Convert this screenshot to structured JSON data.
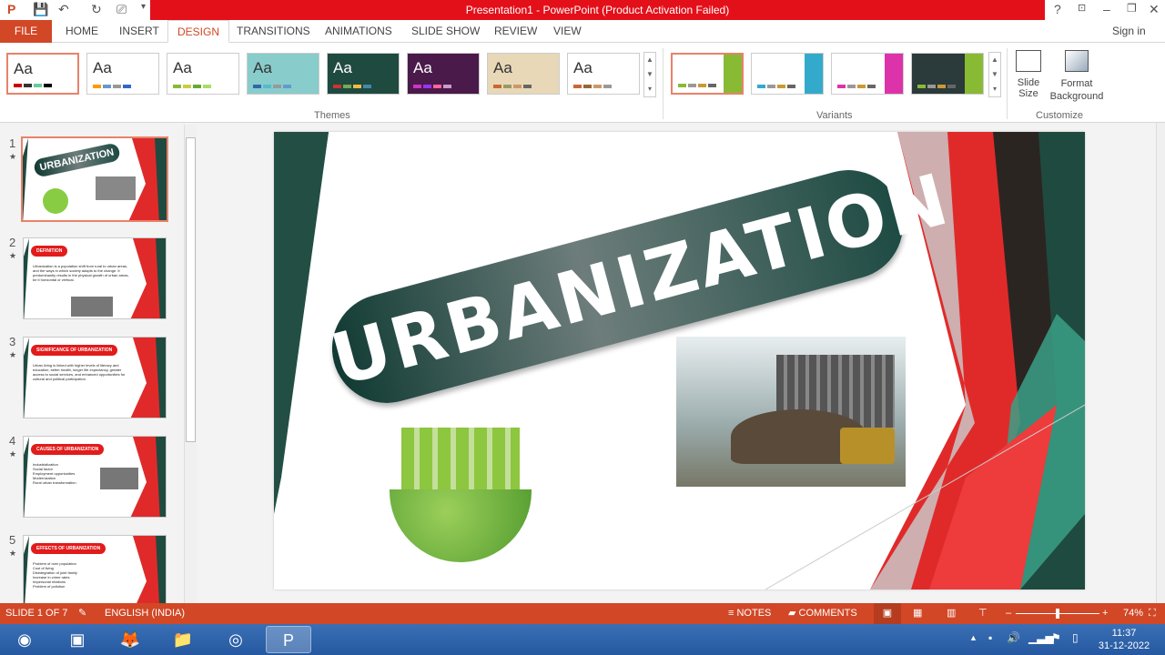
{
  "window": {
    "title": "Presentation1 - PowerPoint (Product Activation Failed)",
    "sign_in": "Sign in",
    "help": "?"
  },
  "tabs": [
    {
      "label": "FILE"
    },
    {
      "label": "HOME"
    },
    {
      "label": "INSERT"
    },
    {
      "label": "DESIGN",
      "active": true
    },
    {
      "label": "TRANSITIONS"
    },
    {
      "label": "ANIMATIONS"
    },
    {
      "label": "SLIDE SHOW"
    },
    {
      "label": "REVIEW"
    },
    {
      "label": "VIEW"
    }
  ],
  "ribbon": {
    "themes_label": "Themes",
    "variants_label": "Variants",
    "customize_label": "Customize",
    "theme_sample": "Aa",
    "slide_size": "Slide Size",
    "format_background": "Format Background"
  },
  "thumbnails": [
    {
      "num": "1",
      "title": "URBANIZATION"
    },
    {
      "num": "2",
      "title": "DEFINITION",
      "body": "Urbanization is a population shift from rural to urban areas, and the ways in which society adapts to the change. It predominantly results in the physical growth of urban areas, be it horizontal or vertical."
    },
    {
      "num": "3",
      "title": "SIGNIFICANCE OF URBANIZATION",
      "body": "Urban living is linked with higher levels of literacy and education, better health, longer life expectancy, greater access to social services, and enhanced opportunities for cultural and political participation."
    },
    {
      "num": "4",
      "title": "CAUSES OF URBANIZATION",
      "items": [
        "Industrialization",
        "Social factor",
        "Employment opportunities",
        "Modernization",
        "Rural urban transformation"
      ]
    },
    {
      "num": "5",
      "title": "EFFECTS OF URBANIZATION",
      "items": [
        "Problem of over population",
        "Cost of living",
        "Disintegration of joint family",
        "Increase in crime rates",
        "Impersonal relations",
        "Problem of pollution"
      ]
    }
  ],
  "slide": {
    "title": "URBANIZATION"
  },
  "status": {
    "slide": "SLIDE 1 OF 7",
    "language": "ENGLISH (INDIA)",
    "notes": "NOTES",
    "comments": "COMMENTS",
    "zoom": "74%",
    "zoom_percent": 74
  },
  "taskbar": {
    "time": "11:37",
    "date": "31-12-2022"
  },
  "colors": {
    "accent": "#d24726",
    "title_bar": "#e3101a",
    "slide_green": "#1f4a40",
    "slide_red": "#e21b1b"
  }
}
